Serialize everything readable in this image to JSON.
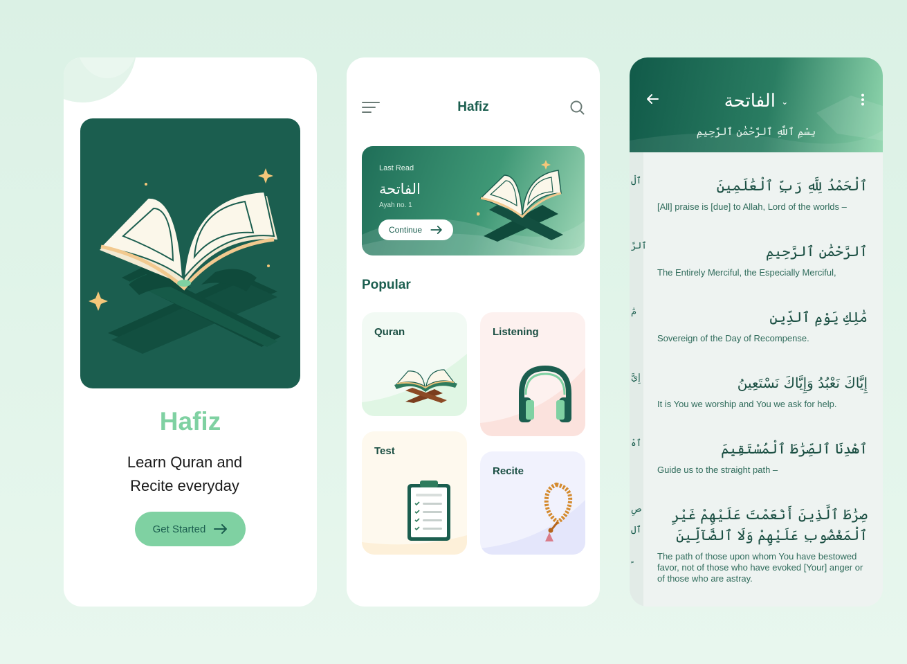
{
  "onboarding": {
    "brand": "Hafiz",
    "tagline_line1": "Learn Quran and",
    "tagline_line2": "Recite everyday",
    "cta_label": "Get Started"
  },
  "home": {
    "title": "Hafiz",
    "last_read": {
      "label": "Last Read",
      "surah": "الفاتحة",
      "ayah": "Ayah no. 1",
      "button_label": "Continue"
    },
    "popular_title": "Popular",
    "categories": [
      {
        "label": "Quran",
        "icon": "quran-book-icon"
      },
      {
        "label": "Listening",
        "icon": "headphones-icon"
      },
      {
        "label": "Test",
        "icon": "clipboard-icon"
      },
      {
        "label": "Recite",
        "icon": "prayer-beads-icon"
      }
    ]
  },
  "reader": {
    "surah_name": "الفاتحة",
    "bismillah": "بِسْمِ ٱللَّهِ ٱلرَّحْمَٰنِ ٱلرَّحِيمِ",
    "verses": [
      {
        "arabic": "ٱلْحَمْدُ لِلَّهِ رَبِّ ٱلْعَٰلَمِينَ",
        "translation": "[All] praise is [due] to Allah, Lord of the worlds –"
      },
      {
        "arabic": "ٱلرَّحْمَٰنِ ٱلرَّحِيمِ",
        "translation": "The Entirely Merciful, the Especially Merciful,"
      },
      {
        "arabic": "مَٰلِكِ يَوْمِ ٱلدِّينِ",
        "translation": "Sovereign of the Day of Recompense."
      },
      {
        "arabic": "إِيَّاكَ نَعْبُدُ وَإِيَّاكَ نَسْتَعِينُ",
        "translation": "It is You we worship and You we ask for help."
      },
      {
        "arabic": "ٱهْدِنَا ٱلصِّرَٰطَ ٱلْمُسْتَقِيمَ",
        "translation": "Guide us to the straight path –"
      },
      {
        "arabic": "صِرَٰطَ ٱلَّذِينَ أَنْعَمْتَ عَلَيْهِمْ غَيْرِ ٱلْمَغْضُوبِ عَلَيْهِمْ وَلَا ٱلضَّآلِّينَ",
        "translation": "The path of those upon whom You have bestowed favor, not of those who have evoked [Your] anger or of those who are astray."
      }
    ],
    "edge_marks": [
      "ٱلْ",
      "ٱلرَّ",
      "مَٰ",
      "إِيَّ",
      "ٱهْ",
      "صِ",
      "ٱل",
      "ﹰ"
    ]
  },
  "colors": {
    "brand_dark": "#1b5e4f",
    "brand_light": "#7fd1a2",
    "background": "#dbf1e5"
  }
}
